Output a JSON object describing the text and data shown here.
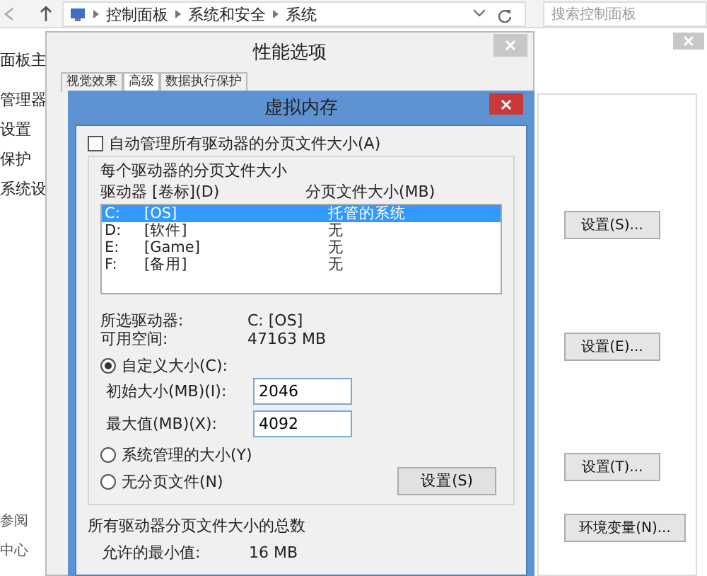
{
  "address_bar": {
    "breadcrumbs": [
      "控制面板",
      "系统和安全",
      "系统"
    ],
    "search": {
      "placeholder": "搜索控制面板"
    }
  },
  "sidebar": {
    "items": [
      "面板主",
      "管理器",
      "设置",
      "保护",
      "系统设"
    ],
    "footer": [
      "参阅",
      "中心"
    ]
  },
  "system_properties": {
    "buttons": [
      "设置(S)...",
      "设置(E)...",
      "设置(T)...",
      "环境变量(N)..."
    ]
  },
  "performance_options": {
    "title": "性能选项",
    "tabs": [
      {
        "label": "视觉效果",
        "selected": false
      },
      {
        "label": "高级",
        "selected": true
      },
      {
        "label": "数据执行保护",
        "selected": false
      }
    ]
  },
  "virtual_memory": {
    "title": "虚拟内存",
    "auto_manage": {
      "label": "自动管理所有驱动器的分页文件大小(A)",
      "checked": false
    },
    "group_title": "每个驱动器的分页文件大小",
    "columns": [
      "驱动器 [卷标](D)",
      "分页文件大小(MB)"
    ],
    "drives": [
      {
        "drive": "C:",
        "volume": "[OS]",
        "size": "托管的系统",
        "selected": true
      },
      {
        "drive": "D:",
        "volume": "[软件]",
        "size": "无",
        "selected": false
      },
      {
        "drive": "E:",
        "volume": "[Game]",
        "size": "无",
        "selected": false
      },
      {
        "drive": "F:",
        "volume": "[备用]",
        "size": "无",
        "selected": false
      }
    ],
    "info": [
      {
        "label": "所选驱动器:",
        "value": "C:  [OS]"
      },
      {
        "label": "可用空间:",
        "value": "47163 MB"
      }
    ],
    "custom_size": {
      "label": "自定义大小(C):",
      "selected": true,
      "fields": [
        {
          "label": "初始大小(MB)(I):",
          "value": "2046"
        },
        {
          "label": "最大值(MB)(X):",
          "value": "4092"
        }
      ]
    },
    "system_managed": {
      "label": "系统管理的大小(Y)",
      "selected": false
    },
    "no_paging": {
      "label": "无分页文件(N)",
      "selected": false
    },
    "set_button": "设置(S)",
    "totals": {
      "title": "所有驱动器分页文件大小的总数",
      "rows": [
        {
          "label": "允许的最小值:",
          "value": "16 MB"
        }
      ]
    }
  }
}
